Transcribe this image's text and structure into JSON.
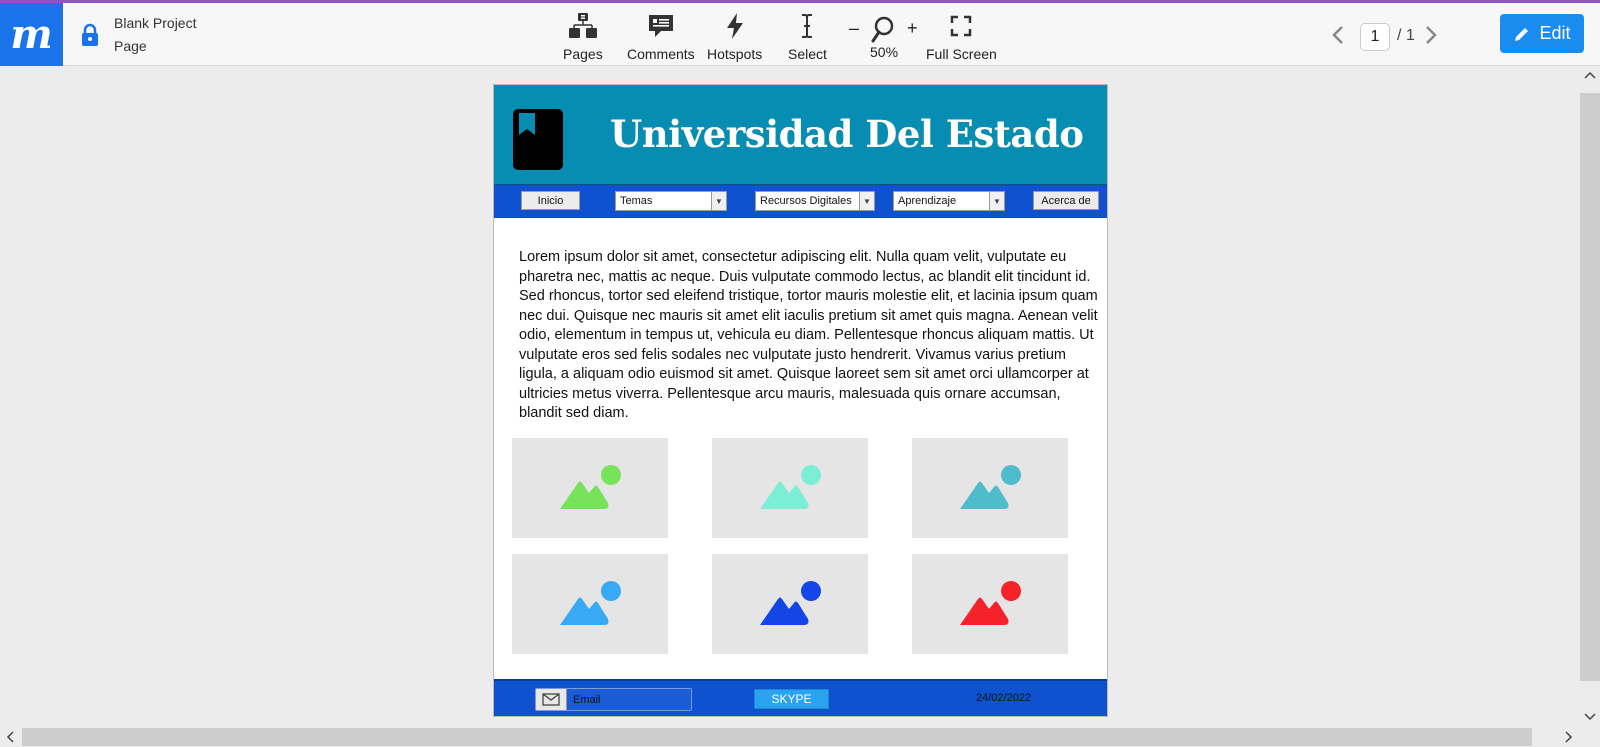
{
  "app": {
    "logo_letter": "m",
    "project_title": "Blank Project",
    "page_name": "Page"
  },
  "toolbar": {
    "pages": "Pages",
    "comments": "Comments",
    "hotspots": "Hotspots",
    "select": "Select",
    "zoom_minus": "–",
    "zoom_plus": "+",
    "zoom_level": "50%",
    "fullscreen": "Full Screen"
  },
  "pager": {
    "current": "1",
    "total": "/ 1"
  },
  "edit_button": "Edit",
  "mockup": {
    "title": "Universidad Del Estado",
    "nav": {
      "inicio": "Inicio",
      "temas": "Temas",
      "recursos": "Recursos Digitales",
      "aprendizaje": "Aprendizaje",
      "acerca": "Acerca de"
    },
    "body_text": "Lorem ipsum dolor sit amet, consectetur adipiscing elit. Nulla quam velit, vulputate eu pharetra nec, mattis ac neque. Duis vulputate commodo lectus, ac blandit elit tincidunt id. Sed rhoncus, tortor sed eleifend tristique, tortor mauris molestie elit, et lacinia ipsum quam nec dui. Quisque nec mauris sit amet elit iaculis pretium sit amet quis magna. Aenean velit odio, elementum in tempus ut, vehicula eu diam. Pellentesque rhoncus aliquam mattis. Ut vulputate eros sed felis sodales nec vulputate justo hendrerit. Vivamus varius pretium ligula, a aliquam odio euismod sit amet. Quisque laoreet sem sit amet orci ullamcorper at ultricies metus viverra. Pellentesque arcu mauris, malesuada quis ornare accumsan, blandit sed diam.",
    "images": [
      {
        "icon": "image-placeholder-icon",
        "color": "#77e35a"
      },
      {
        "icon": "image-placeholder-icon",
        "color": "#7ceed6"
      },
      {
        "icon": "image-placeholder-icon",
        "color": "#4ebccb"
      },
      {
        "icon": "image-placeholder-icon",
        "color": "#38a9f5"
      },
      {
        "icon": "image-placeholder-icon",
        "color": "#1445e6"
      },
      {
        "icon": "image-placeholder-icon",
        "color": "#f6222a"
      }
    ],
    "footer": {
      "email": "Email",
      "skype": "SKYPE",
      "date": "24/02/2022"
    }
  },
  "colors": {
    "accent": "#1a73e8",
    "banner": "#078cb2",
    "nav": "#0f52cf"
  }
}
